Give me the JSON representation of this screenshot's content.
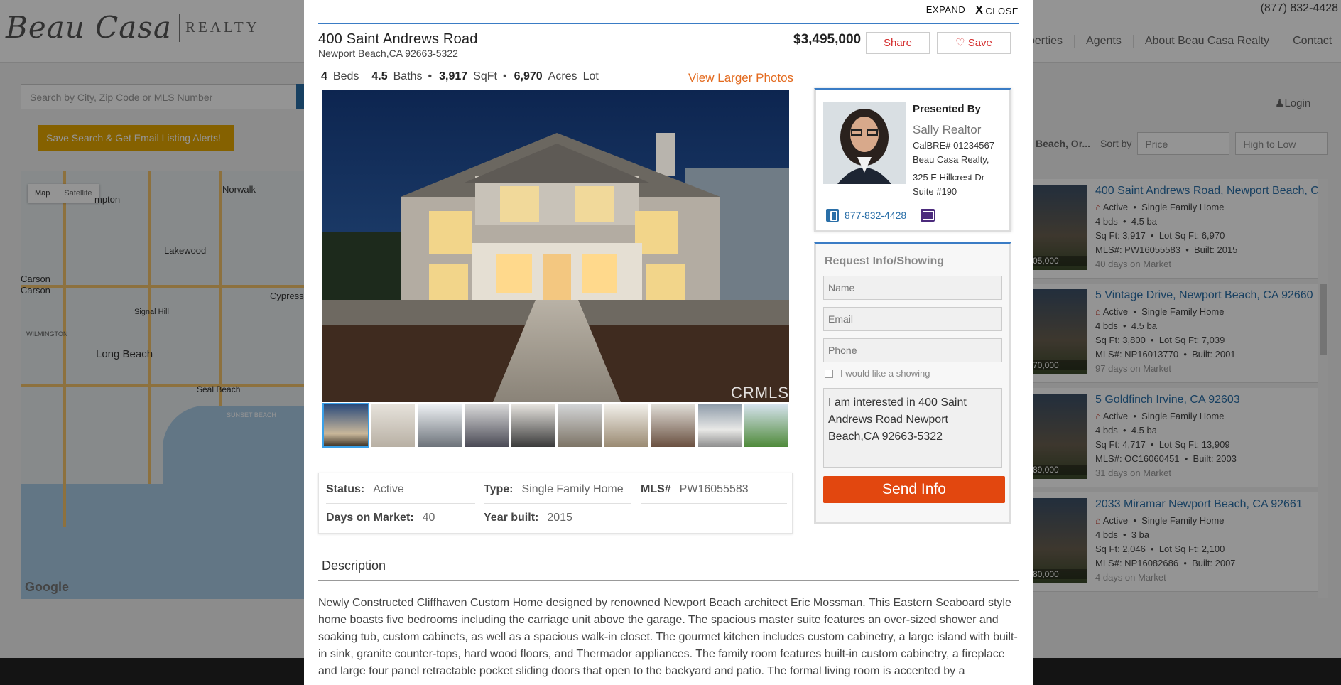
{
  "background": {
    "logo": {
      "script": "Beau Casa",
      "word": "REALTY"
    },
    "phone": "(877) 832-4428",
    "nav": [
      "perties",
      "Agents",
      "About Beau Casa Realty",
      "Contact"
    ],
    "search_placeholder": "Search by City, Zip Code or MLS Number",
    "alert_button": "Save Search & Get Email Listing Alerts!",
    "map": {
      "toggle": [
        "Map",
        "Satellite"
      ],
      "labels": [
        "Norwalk",
        "mpton",
        "Lakewood",
        "Carson",
        "Carson",
        "Signal Hill",
        "Cypress",
        "Long Beach",
        "Seal Beach",
        "WILMINGTON",
        "SUNSET BEACH"
      ],
      "google": "Google"
    },
    "login": "Login",
    "sort_label": "Sort by",
    "sort_field": "Price",
    "sort_order": "High to Low",
    "search_location": "Beach, Or...",
    "results": [
      {
        "price": "05,000",
        "address": "400 Saint Andrews Road, Newport Beach, C",
        "status": "Active",
        "type": "Single Family Home",
        "beds": "4 bds",
        "baths": "4.5 ba",
        "sqft": "Sq Ft: 3,917",
        "lot": "Lot Sq Ft: 6,970",
        "mls": "MLS#: PW16055583",
        "built": "Built: 2015",
        "dom_n": "40",
        "dom": "days on Market"
      },
      {
        "price": "70,000",
        "address": "5 Vintage Drive, Newport Beach, CA 92660",
        "status": "Active",
        "type": "Single Family Home",
        "beds": "4 bds",
        "baths": "4.5 ba",
        "sqft": "Sq Ft: 3,800",
        "lot": "Lot Sq Ft: 7,039",
        "mls": "MLS#: NP16013770",
        "built": "Built: 2001",
        "dom_n": "97",
        "dom": "days on Market"
      },
      {
        "price": "89,000",
        "address": "5 Goldfinch Irvine, CA 92603",
        "status": "Active",
        "type": "Single Family Home",
        "beds": "4 bds",
        "baths": "4.5 ba",
        "sqft": "Sq Ft: 4,717",
        "lot": "Lot Sq Ft: 13,909",
        "mls": "MLS#: OC16060451",
        "built": "Built: 2003",
        "dom_n": "31",
        "dom": "days on Market"
      },
      {
        "price": "80,000",
        "address": "2033 Miramar Newport Beach, CA 92661",
        "status": "Active",
        "type": "Single Family Home",
        "beds": "4 bds",
        "baths": "3 ba",
        "sqft": "Sq Ft: 2,046",
        "lot": "Lot Sq Ft: 2,100",
        "mls": "MLS#: NP16082686",
        "built": "Built: 2007",
        "dom_n": "4",
        "dom": "days on Market"
      }
    ]
  },
  "modal": {
    "expand": "EXPAND",
    "close_x": "X",
    "close": "CLOSE",
    "title": "400 Saint Andrews Road",
    "subtitle": "Newport Beach,CA 92663-5322",
    "price": "$3,495,000",
    "share": "Share",
    "save": "Save",
    "facts": {
      "beds_n": "4",
      "beds": "Beds",
      "baths_n": "4.5",
      "baths": "Baths",
      "sqft_n": "3,917",
      "sqft": "SqFt",
      "acres_n": "6,970",
      "acres": "Acres",
      "lot": "Lot"
    },
    "view_larger": "View Larger Photos",
    "watermark": "CRMLS",
    "info": {
      "status_label": "Status:",
      "status": "Active",
      "type_label": "Type:",
      "type": "Single Family Home",
      "mls_label": "MLS#",
      "mls": "PW16055583",
      "dom_label": "Days on Market:",
      "dom": "40",
      "year_label": "Year built:",
      "year": "2015"
    },
    "description_heading": "Description",
    "description": "Newly Constructed Cliffhaven Custom Home designed by renowned Newport Beach architect Eric Mossman. This Eastern Seaboard style home boasts five bedrooms including the carriage unit above the garage. The spacious master suite features an over-sized shower and soaking tub, custom cabinets, as well as a spacious walk-in closet. The gourmet kitchen includes custom cabinetry, a large island with built-in sink, granite counter-tops, hard wood floors, and Thermador appliances. The family room features built-in custom cabinetry, a fireplace and large four panel retractable pocket sliding doors that open to the backyard and patio. The formal living room is accented by a",
    "agent": {
      "presented_by": "Presented By",
      "name": "Sally Realtor",
      "license": "CalBRE# 01234567",
      "company": "Beau Casa Realty,",
      "address1": "325 E Hillcrest Dr",
      "address2": "Suite #190",
      "phone": "877-832-4428"
    },
    "request": {
      "title": "Request Info/Showing",
      "name_placeholder": "Name",
      "email_placeholder": "Email",
      "phone_placeholder": "Phone",
      "showing_label": "I would like a showing",
      "message": "I am interested in 400 Saint Andrews Road Newport Beach,CA 92663-5322",
      "send": "Send Info"
    }
  }
}
